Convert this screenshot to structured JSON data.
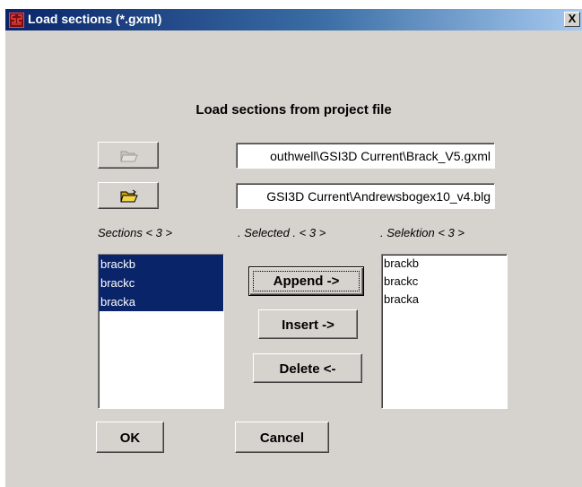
{
  "window": {
    "title": "Load sections (*.gxml)",
    "close_label": "X",
    "icon_text": "GSI 3D"
  },
  "heading": "Load sections from project file",
  "fields": {
    "project_file": "outhwell\\GSI3D Current\\Brack_V5.gxml",
    "bogex_file": "GSI3D Current\\Andrewsbogex10_v4.blg"
  },
  "labels": {
    "sections": "Sections < 3 >",
    "selected": ". Selected . < 3 >",
    "selektion": ".   Selektion < 3 >"
  },
  "sections_list": [
    {
      "label": "brackb",
      "selected": true
    },
    {
      "label": "brackc",
      "selected": true
    },
    {
      "label": "bracka",
      "selected": true
    }
  ],
  "selektion_list": [
    "brackb",
    "brackc",
    "bracka"
  ],
  "buttons": {
    "append": "Append  ->",
    "insert": "Insert ->",
    "delete": "Delete  <-",
    "ok": "OK",
    "cancel": "Cancel"
  },
  "icons": {
    "folder_disabled": "folder-open-icon",
    "folder": "folder-open-icon"
  }
}
